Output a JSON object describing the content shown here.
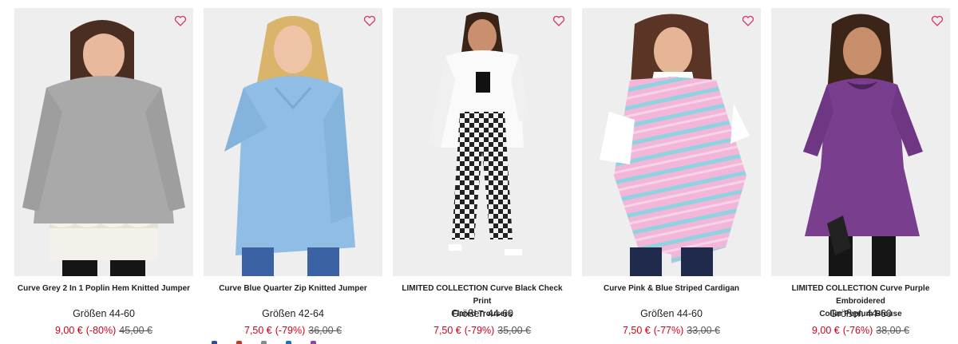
{
  "products": [
    {
      "title": "Curve Grey 2 In 1 Poplin Hem Knitted Jumper",
      "title_line2": "",
      "sizes": "Größen 44-60",
      "price": "9,00 €",
      "discount": "(-80%)",
      "old_price": "45,00 €",
      "wishlist_icon": "heart-outline-icon"
    },
    {
      "title": "Curve Blue Quarter Zip Knitted Jumper",
      "title_line2": "",
      "sizes": "Größen 42-64",
      "price": "7,50 €",
      "discount": "(-79%)",
      "old_price": "36,00 €",
      "wishlist_icon": "heart-outline-icon"
    },
    {
      "title": "LIMITED COLLECTION Curve Black Check Print",
      "title_line2": "Flared Trousers",
      "sizes": "Größen 44-60",
      "price": "7,50 €",
      "discount": "(-79%)",
      "old_price": "35,00 €",
      "wishlist_icon": "heart-outline-icon"
    },
    {
      "title": "Curve Pink & Blue Striped Cardigan",
      "title_line2": "",
      "sizes": "Größen 44-60",
      "price": "7,50 €",
      "discount": "(-77%)",
      "old_price": "33,00 €",
      "wishlist_icon": "heart-outline-icon"
    },
    {
      "title": "LIMITED COLLECTION Curve Purple Embroidered",
      "title_line2": "Collar Peplum Blouse",
      "sizes": "Größen 44-60",
      "price": "9,00 €",
      "discount": "(-76%)",
      "old_price": "38,00 €",
      "wishlist_icon": "heart-outline-icon"
    }
  ],
  "colors": {
    "sale_red": "#d0021b",
    "wishlist_pink": "#d6336c",
    "image_bg": "#efefef"
  },
  "colour_swatches": [
    "#2b4f8f",
    "#c0392b",
    "#7f8c8d",
    "#1f6fb2",
    "#8e44ad"
  ]
}
